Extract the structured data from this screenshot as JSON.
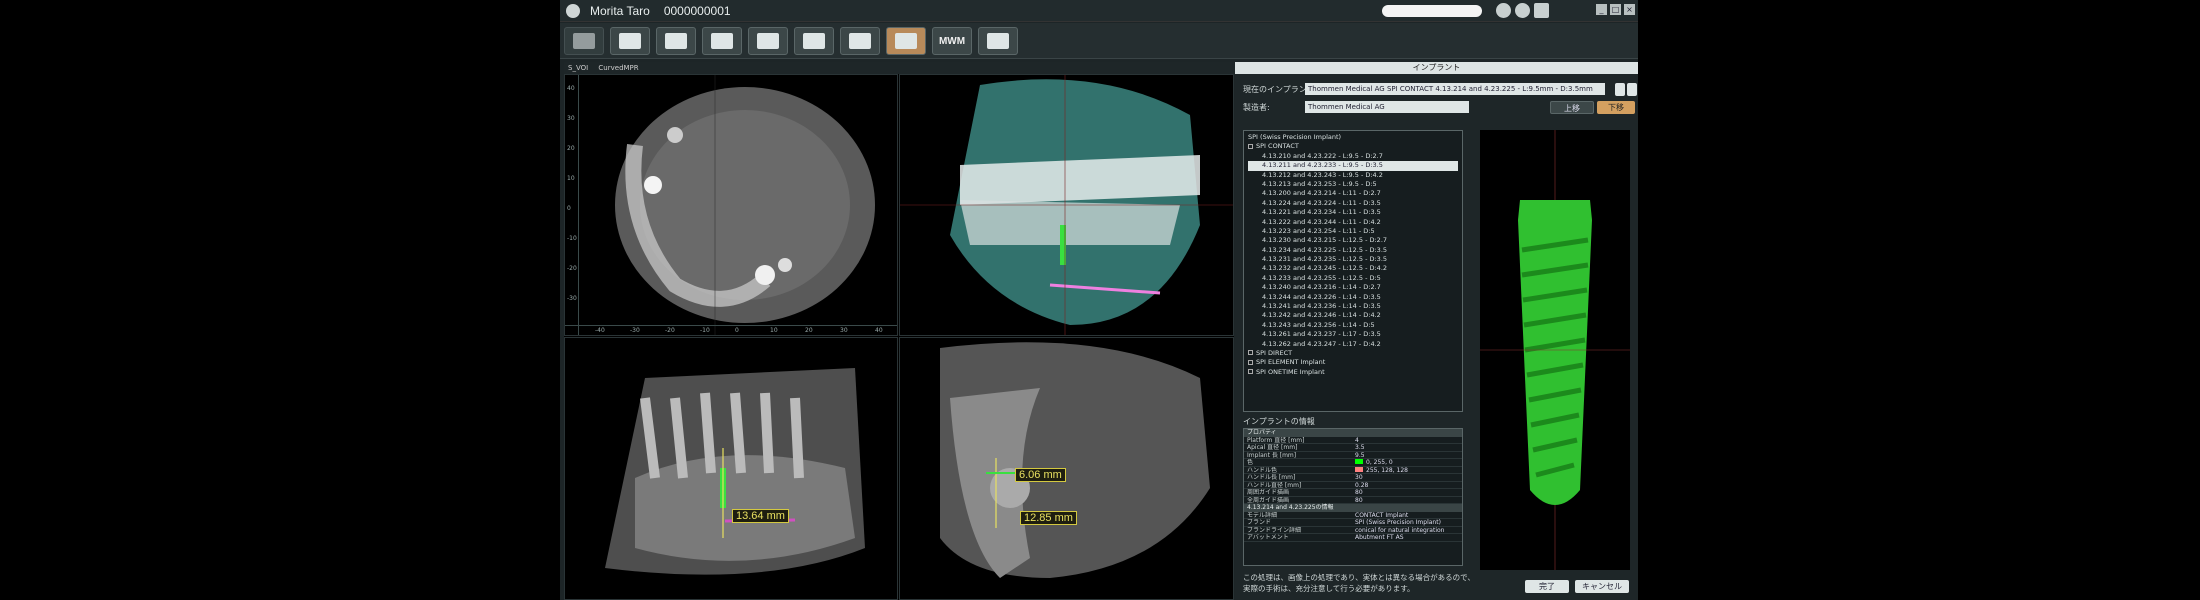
{
  "app": {
    "patient_name": "Morita Taro",
    "patient_id": "0000000001"
  },
  "window_controls": [
    "_",
    "□",
    "×"
  ],
  "toolbar": {
    "mwm_label": "MWM"
  },
  "viewer": {
    "tabs": [
      "S_VOI",
      "CurvedMPR"
    ],
    "measurements": [
      "13.64 mm",
      "6.06 mm",
      "12.85 mm"
    ],
    "v_ticks": [
      "40",
      "30",
      "20",
      "10",
      "0",
      "-10",
      "-20",
      "-30",
      "-40"
    ],
    "h_ticks": [
      "-40",
      "-30",
      "-20",
      "-10",
      "0",
      "10",
      "20",
      "30",
      "40"
    ]
  },
  "panel": {
    "title": "インプラント",
    "implant_label": "現在のインプラント:",
    "implant_value": "Thommen Medical AG SPI CONTACT 4.13.214 and 4.23.225 - L:9.5mm - D:3.5mm",
    "manufacturer_label": "製造者:",
    "manufacturer_value": "Thommen Medical AG",
    "up_btn": "上移",
    "down_btn": "下移",
    "tree": {
      "root": "SPI (Swiss Precision Implant)",
      "group": "SPI CONTACT",
      "items": [
        "4.13.210 and 4.23.222 - L:9.5 - D:2.7",
        "4.13.211 and 4.23.233 - L:9.5 - D:3.5",
        "4.13.212 and 4.23.243 - L:9.5 - D:4.2",
        "4.13.213 and 4.23.253 - L:9.5 - D:5",
        "4.13.200 and 4.23.214 - L:11 - D:2.7",
        "4.13.224 and 4.23.224 - L:11 - D:3.5",
        "4.13.221 and 4.23.234 - L:11 - D:3.5",
        "4.13.222 and 4.23.244 - L:11 - D:4.2",
        "4.13.223 and 4.23.254 - L:11 - D:5",
        "4.13.230 and 4.23.215 - L:12.5 - D:2.7",
        "4.13.234 and 4.23.225 - L:12.5 - D:3.5",
        "4.13.231 and 4.23.235 - L:12.5 - D:3.5",
        "4.13.232 and 4.23.245 - L:12.5 - D:4.2",
        "4.13.233 and 4.23.255 - L:12.5 - D:5",
        "4.13.240 and 4.23.216 - L:14 - D:2.7",
        "4.13.244 and 4.23.226 - L:14 - D:3.5",
        "4.13.241 and 4.23.236 - L:14 - D:3.5",
        "4.13.242 and 4.23.246 - L:14 - D:4.2",
        "4.13.243 and 4.23.256 - L:14 - D:5",
        "4.13.261 and 4.23.237 - L:17 - D:3.5",
        "4.13.262 and 4.23.247 - L:17 - D:4.2"
      ],
      "others": [
        "SPI DIRECT",
        "SPI ELEMENT Implant",
        "SPI ONETIME Implant"
      ]
    },
    "info_label": "インプラントの情報",
    "info": {
      "section1": "プロパティ",
      "rows1": [
        {
          "k": "Platform 直径 [mm]",
          "v": "4"
        },
        {
          "k": "Apical 直径 [mm]",
          "v": "3.5"
        },
        {
          "k": "Implant 長 [mm]",
          "v": "9.5"
        },
        {
          "k": "色",
          "v": "0, 255, 0"
        },
        {
          "k": "ハンドル色",
          "v": "255, 128, 128"
        },
        {
          "k": "ハンドル長 [mm]",
          "v": "30"
        },
        {
          "k": "ハンドル直径 [mm]",
          "v": "0.28"
        },
        {
          "k": "周囲ガイド描画",
          "v": "80"
        },
        {
          "k": "全周ガイド描画",
          "v": "80"
        }
      ],
      "section2": "4.13.214 and 4.23.225の情報",
      "rows2": [
        {
          "k": "モデル詳細",
          "v": "CONTACT Implant"
        },
        {
          "k": "ブランド",
          "v": "SPI (Swiss Precision Implant)"
        },
        {
          "k": "ブランドライン詳細",
          "v": "conical for natural integration"
        },
        {
          "k": "アバットメント",
          "v": "Abutment FT AS"
        }
      ]
    },
    "note_line1": "この処理は、画像上の処理であり、実体とは異なる場合があるので、",
    "note_line2": "実際の手術は、充分注意して行う必要があります。",
    "ok_btn": "完了",
    "cancel_btn": "キャンセル"
  }
}
